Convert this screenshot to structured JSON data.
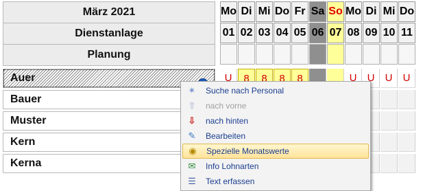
{
  "header": {
    "month": "März 2021",
    "dienstanlage": "Dienstanlage",
    "planung": "Planung"
  },
  "days": [
    {
      "wd": "Mo",
      "num": "01",
      "type": "normal"
    },
    {
      "wd": "Di",
      "num": "02",
      "type": "normal"
    },
    {
      "wd": "Mi",
      "num": "03",
      "type": "normal"
    },
    {
      "wd": "Do",
      "num": "04",
      "type": "normal"
    },
    {
      "wd": "Fr",
      "num": "05",
      "type": "normal"
    },
    {
      "wd": "Sa",
      "num": "06",
      "type": "sa"
    },
    {
      "wd": "So",
      "num": "07",
      "type": "so"
    },
    {
      "wd": "Mo",
      "num": "08",
      "type": "normal"
    },
    {
      "wd": "Di",
      "num": "09",
      "type": "normal"
    },
    {
      "wd": "Mi",
      "num": "10",
      "type": "normal"
    },
    {
      "wd": "Do",
      "num": "11",
      "type": "normal"
    }
  ],
  "employees": [
    {
      "name": "Auer",
      "selected": true
    },
    {
      "name": "Bauer",
      "selected": false
    },
    {
      "name": "Muster",
      "selected": false
    },
    {
      "name": "Kern",
      "selected": false
    },
    {
      "name": "Kerna",
      "selected": false
    }
  ],
  "auer_row": [
    "U",
    "8",
    "8",
    "8",
    "8",
    "",
    "",
    "U",
    "U",
    "U",
    "U"
  ],
  "context_menu": {
    "items": [
      {
        "label": "Suche nach Personal",
        "icon": "search-person-icon",
        "disabled": false,
        "highlighted": false
      },
      {
        "label": "nach vorne",
        "icon": "arrow-up-icon",
        "disabled": true,
        "highlighted": false
      },
      {
        "label": "nach hinten",
        "icon": "arrow-down-icon",
        "disabled": false,
        "highlighted": false
      },
      {
        "label": "Bearbeiten",
        "icon": "edit-icon",
        "disabled": false,
        "highlighted": false
      },
      {
        "label": "Spezielle Monatswerte",
        "icon": "money-bag-icon",
        "disabled": false,
        "highlighted": true
      },
      {
        "label": "Info Lohnarten",
        "icon": "info-mail-icon",
        "disabled": false,
        "highlighted": false
      },
      {
        "label": "Text erfassen",
        "icon": "text-document-icon",
        "disabled": false,
        "highlighted": false
      }
    ]
  },
  "colors": {
    "saturday": "#8f8f8f",
    "sunday": "#ffff99",
    "sunday_label": "#e00000",
    "absence_u": "#d00000",
    "menu_text": "#1a3d8f"
  }
}
